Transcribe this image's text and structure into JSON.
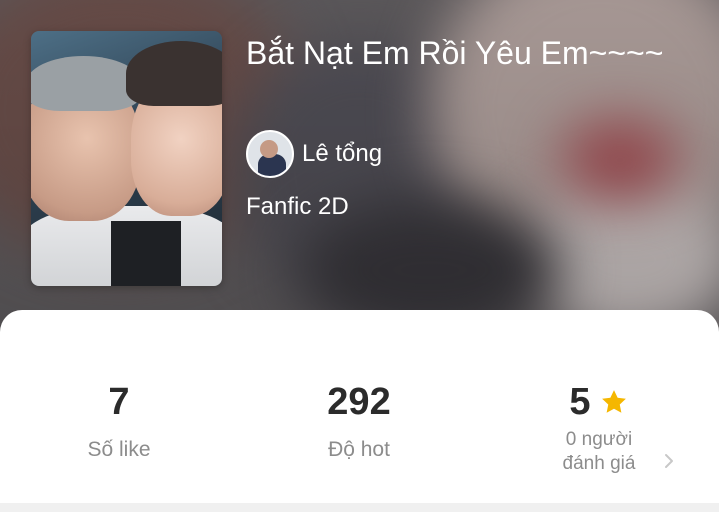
{
  "book": {
    "title": "Bắt Nạt Em Rồi Yêu Em~~~~",
    "author": "Lê tổng",
    "genre": "Fanfic 2D",
    "cover_icon": "cover-image",
    "avatar_icon": "author-avatar"
  },
  "stats": {
    "likes": {
      "value": "7",
      "label": "Số like"
    },
    "hot": {
      "value": "292",
      "label": "Độ hot"
    },
    "rating": {
      "value": "5",
      "label_line1": "0 người",
      "label_line2": "đánh giá",
      "icon": "star-icon",
      "icon_color": "#F5B700"
    }
  },
  "colors": {
    "card": "#FFFFFF",
    "text_dark": "#2B2B2B",
    "text_muted": "#8C8C8C"
  }
}
